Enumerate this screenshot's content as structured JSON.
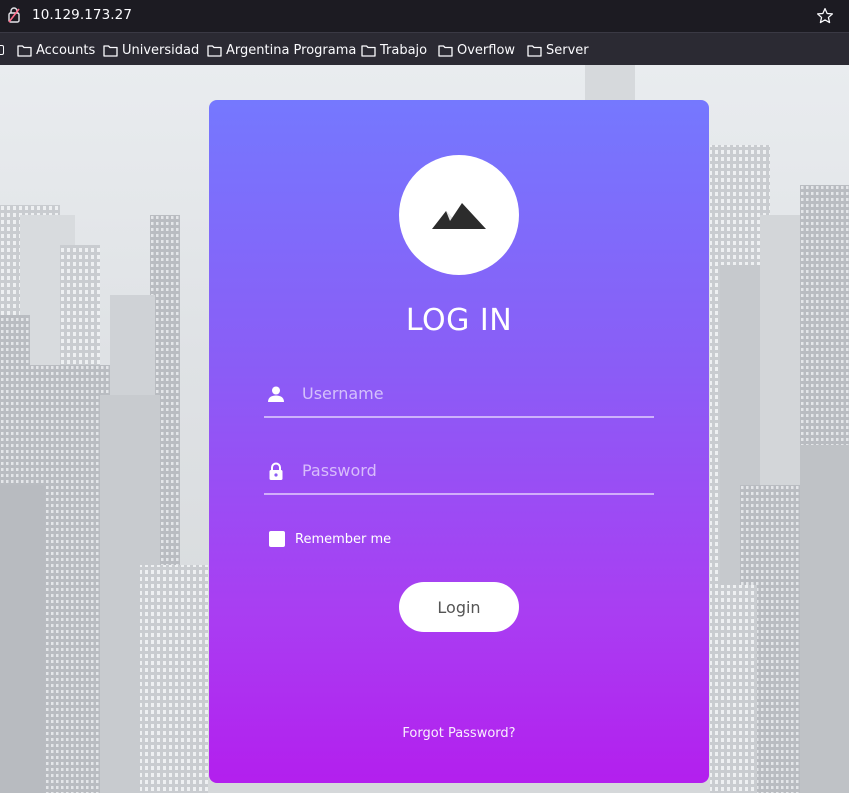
{
  "browser": {
    "url": "10.129.173.27",
    "bookmarks": [
      {
        "label": "Accounts",
        "icon": "folder-icon"
      },
      {
        "label": "Universidad",
        "icon": "folder-icon"
      },
      {
        "label": "Argentina Programa",
        "icon": "folder-icon"
      },
      {
        "label": "Trabajo",
        "icon": "folder-icon"
      },
      {
        "label": "Overflow",
        "icon": "folder-icon"
      },
      {
        "label": "Server",
        "icon": "folder-icon"
      }
    ]
  },
  "login": {
    "logo_icon": "mountain-icon",
    "title": "LOG IN",
    "username_placeholder": "Username",
    "username_icon": "user-icon",
    "password_placeholder": "Password",
    "password_icon": "lock-icon",
    "remember_label": "Remember me",
    "remember_checked": false,
    "login_label": "Login",
    "forgot_label": "Forgot Password?"
  },
  "colors": {
    "card_top": "#7578fe",
    "card_bottom": "#b31fee",
    "browser_chrome": "#2b2a33"
  }
}
